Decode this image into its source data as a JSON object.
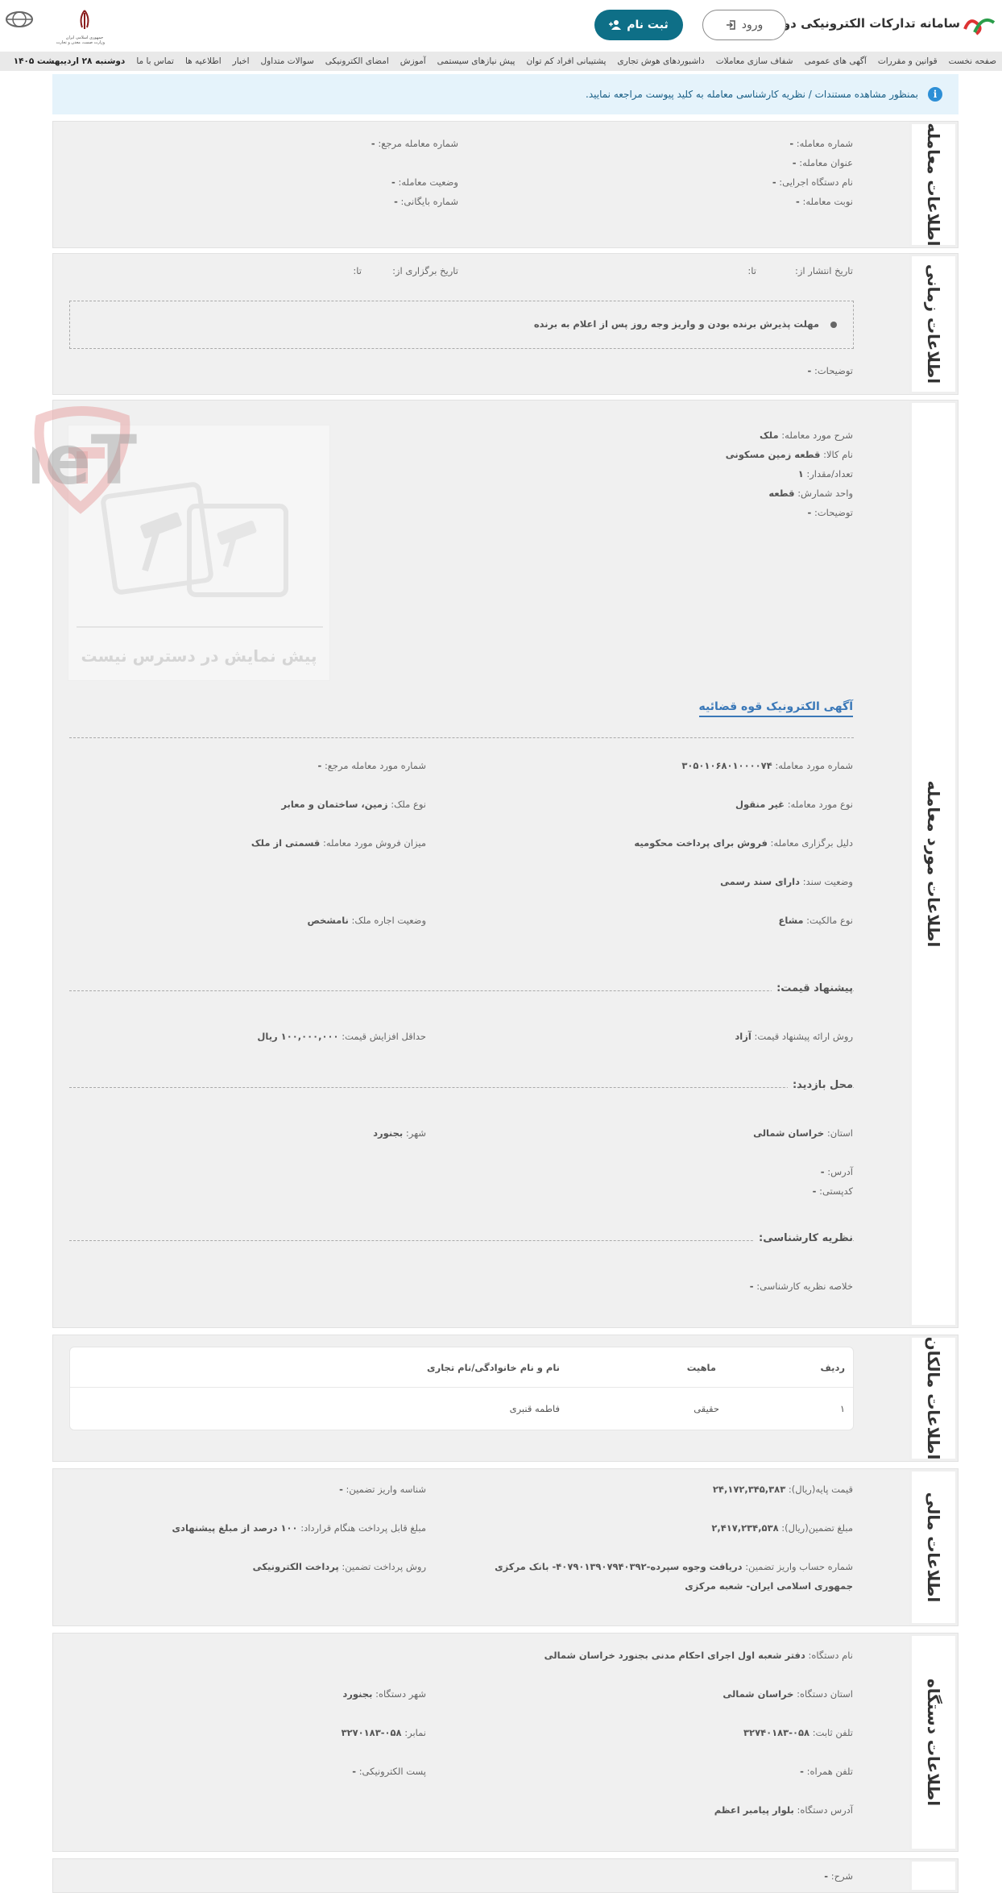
{
  "header": {
    "site_title": "سامانه تدارکات الکترونیکی دولت",
    "login_label": "ورود",
    "register_label": "ثبت نام",
    "gov_logo_line1": "جمهوری اسلامی ایران",
    "gov_logo_line2": "وزارت صمت، معدن و تجارت"
  },
  "nav": {
    "items": [
      "صفحه نخست",
      "قوانین و مقررات",
      "آگهی های عمومی",
      "شفاف سازی معاملات",
      "داشبوردهای هوش تجاری",
      "پشتیبانی افراد کم توان",
      "پیش نیازهای سیستمی",
      "آموزش",
      "امضای الکترونیکی",
      "سوالات متداول",
      "اخبار",
      "اطلاعیه ها",
      "تماس با ما"
    ],
    "date": "دوشنبه ۲۸ اردیبهشت ۱۴۰۵"
  },
  "notice": {
    "icon": "info-icon",
    "text": "بمنظور مشاهده مستندات / نظریه کارشناسی معامله به کلید پیوست مراجعه نمایید."
  },
  "deal": {
    "title": "اطلاعات معامله",
    "number_label": "شماره معامله:",
    "number": "-",
    "ref_number_label": "شماره معامله مرجع:",
    "ref_number": "-",
    "subject_label": "عنوان معامله:",
    "subject": "-",
    "agency_label": "نام دستگاه اجرایی:",
    "agency": "-",
    "status_label": "وضعیت معامله:",
    "status": "-",
    "turn_label": "نوبت معامله:",
    "turn": "-",
    "archive_label": "شماره بایگانی:",
    "archive": "-"
  },
  "timing": {
    "title": "اطلاعات زمانی",
    "publish_from_label": "تاریخ انتشار از:",
    "publish_to_label": "تا:",
    "hold_from_label": "تاریخ برگزاری از:",
    "hold_to_label": "تا:",
    "deadline_label": "مهلت پذیرش برنده بودن و واریز وجه روز پس از اعلام به برنده",
    "desc_label": "توضیحات:",
    "desc": "-"
  },
  "item": {
    "title": "اطلاعات مورد معامله",
    "desc_label": "شرح مورد معامله:",
    "desc": "ملک",
    "goods_label": "نام کالا:",
    "goods": "قطعه زمین مسکونی",
    "qty_label": "تعداد/مقدار:",
    "qty": "۱",
    "unit_label": "واحد شمارش:",
    "unit": "قطعه",
    "notes_label": "توضیحات:",
    "notes": "-",
    "no_preview": "پیش نمایش در دسترس نیست",
    "ad_link": "آگهی الکترونیک قوه قضائیه",
    "case_no_label": "شماره مورد معامله:",
    "case_no": "۳۰۵۰۱۰۶۸۰۱۰۰۰۰۷۴",
    "ref_case_no_label": "شماره مورد معامله مرجع:",
    "ref_case_no": "-",
    "type_label": "نوع مورد معامله:",
    "type": "غیر منقول",
    "property_type_label": "نوع ملک:",
    "property_type": "زمین، ساختمان و معابر",
    "reason_label": "دلیل برگزاری معامله:",
    "reason": "فروش برای پرداخت محکومیه",
    "sale_amount_label": "میزان فروش مورد معامله:",
    "sale_amount": "قسمتی از ملک",
    "doc_status_label": "وضعیت سند:",
    "doc_status": "دارای سند رسمی",
    "ownership_label": "نوع مالکیت:",
    "ownership": "مشاع",
    "lease_label": "وضعیت اجاره ملک:",
    "lease": "نامشخص",
    "price_offer_heading": "پیشنهاد قیمت:",
    "offer_method_label": "روش ارائه پیشنهاد قیمت:",
    "offer_method": "آزاد",
    "min_increase_label": "حداقل افزایش قیمت:",
    "min_increase": "۱۰۰,۰۰۰,۰۰۰ ریال",
    "visit_heading": "محل بازدید:",
    "province_label": "استان:",
    "province": "خراسان شمالی",
    "city_label": "شهر:",
    "city": "بجنورد",
    "address_label": "آدرس:",
    "address": "-",
    "postal_label": "کدپستی:",
    "postal": "-",
    "expert_heading": "نظریه کارشناسی:",
    "expert_summary_label": "خلاصه نظریه کارشناسی:",
    "expert_summary": "-"
  },
  "owners": {
    "title": "اطلاعات مالکان",
    "headers": [
      "ردیف",
      "ماهیت",
      "نام و نام خانوادگی/نام تجاری"
    ],
    "rows": [
      [
        "۱",
        "حقیقی",
        "فاطمه قنبری"
      ]
    ]
  },
  "finance": {
    "title": "اطلاعات مالی",
    "base_price_label": "قیمت پایه(ریال):",
    "base_price": "۲۴,۱۷۲,۳۴۵,۳۸۳",
    "guarantee_id_label": "شناسه واریز تضمین:",
    "guarantee_id": "-",
    "guarantee_amount_label": "مبلغ تضمین(ریال):",
    "guarantee_amount": "۲,۴۱۷,۲۳۴,۵۳۸",
    "payable_label": "مبلغ قابل پرداخت هنگام قرارداد:",
    "payable": "۱۰۰ درصد از مبلغ پیشنهادی",
    "account_label": "شماره حساب واریز تضمین:",
    "account_line1": "دریافت وجوه سپرده-۴۰۷۹۰۱۳۹۰۷۹۴۰۳۹۲- بانک مرکزی",
    "account_line2": "جمهوری اسلامی ایران- شعبه مرکزی",
    "pay_method_label": "روش پرداخت تضمین:",
    "pay_method": "پرداخت الکترونیکی"
  },
  "agency": {
    "title": "اطلاعات دستگاه",
    "name_label": "نام دستگاه:",
    "name": "دفتر شعبه اول اجرای احکام مدنی بجنورد خراسان شمالی",
    "province_label": "استان دستگاه:",
    "province": "خراسان شمالی",
    "city_label": "شهر دستگاه:",
    "city": "بجنورد",
    "phone_label": "تلفن ثابت:",
    "phone": "۰۵۸-۳۲۷۴۰۱۸۳",
    "fax_label": "نمابر:",
    "fax": "۰۵۸-۳۲۷۰۱۸۳",
    "mobile_label": "تلفن همراه:",
    "mobile": "-",
    "email_label": "پست الکترونیکی:",
    "email": "-",
    "address_label": "آدرس دستگاه:",
    "address": "بلوار پیامبر اعظم"
  },
  "extra": {
    "desc_label": "شرح:",
    "desc": "-"
  },
  "colors": {
    "primary": "#0e6f87",
    "link": "#3a78b8",
    "notice_bg": "#e5f3fb",
    "section_bg": "#f0f0f0"
  },
  "watermark": {
    "text": "AriaTender.neT"
  }
}
